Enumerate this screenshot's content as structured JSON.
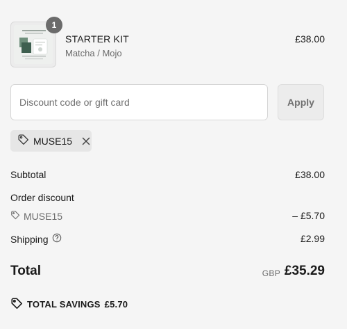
{
  "product": {
    "quantity": "1",
    "name": "STARTER KIT",
    "variant": "Matcha / Mojo",
    "price": "£38.00"
  },
  "discount": {
    "placeholder": "Discount code or gift card",
    "apply_label": "Apply",
    "applied_code": "MUSE15"
  },
  "summary": {
    "subtotal_label": "Subtotal",
    "subtotal_value": "£38.00",
    "order_discount_label": "Order discount",
    "discount_code": "MUSE15",
    "discount_value": "– £5.70",
    "shipping_label": "Shipping",
    "shipping_value": "£2.99",
    "total_label": "Total",
    "currency": "GBP",
    "total_value": "£35.29",
    "savings_label": "TOTAL SAVINGS",
    "savings_value": "£5.70"
  },
  "icons": {
    "tag": "tag-icon",
    "remove": "close-icon",
    "help": "question-circle-icon"
  }
}
